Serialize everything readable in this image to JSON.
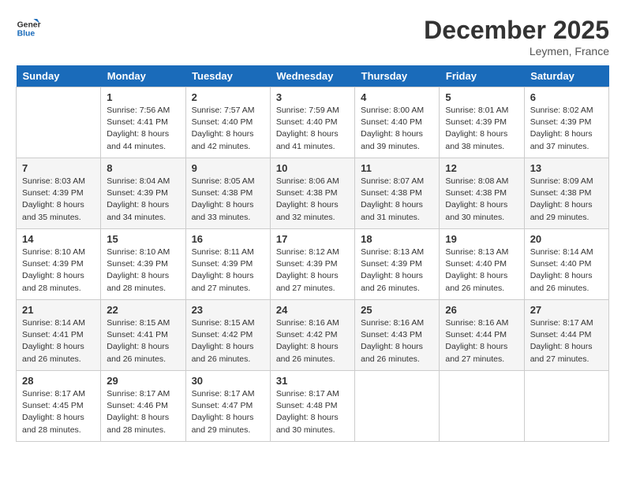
{
  "header": {
    "logo_line1": "General",
    "logo_line2": "Blue",
    "month_title": "December 2025",
    "location": "Leymen, France"
  },
  "days_of_week": [
    "Sunday",
    "Monday",
    "Tuesday",
    "Wednesday",
    "Thursday",
    "Friday",
    "Saturday"
  ],
  "weeks": [
    [
      {
        "day": "",
        "sunrise": "",
        "sunset": "",
        "daylight": ""
      },
      {
        "day": "1",
        "sunrise": "Sunrise: 7:56 AM",
        "sunset": "Sunset: 4:41 PM",
        "daylight": "Daylight: 8 hours and 44 minutes."
      },
      {
        "day": "2",
        "sunrise": "Sunrise: 7:57 AM",
        "sunset": "Sunset: 4:40 PM",
        "daylight": "Daylight: 8 hours and 42 minutes."
      },
      {
        "day": "3",
        "sunrise": "Sunrise: 7:59 AM",
        "sunset": "Sunset: 4:40 PM",
        "daylight": "Daylight: 8 hours and 41 minutes."
      },
      {
        "day": "4",
        "sunrise": "Sunrise: 8:00 AM",
        "sunset": "Sunset: 4:40 PM",
        "daylight": "Daylight: 8 hours and 39 minutes."
      },
      {
        "day": "5",
        "sunrise": "Sunrise: 8:01 AM",
        "sunset": "Sunset: 4:39 PM",
        "daylight": "Daylight: 8 hours and 38 minutes."
      },
      {
        "day": "6",
        "sunrise": "Sunrise: 8:02 AM",
        "sunset": "Sunset: 4:39 PM",
        "daylight": "Daylight: 8 hours and 37 minutes."
      }
    ],
    [
      {
        "day": "7",
        "sunrise": "Sunrise: 8:03 AM",
        "sunset": "Sunset: 4:39 PM",
        "daylight": "Daylight: 8 hours and 35 minutes."
      },
      {
        "day": "8",
        "sunrise": "Sunrise: 8:04 AM",
        "sunset": "Sunset: 4:39 PM",
        "daylight": "Daylight: 8 hours and 34 minutes."
      },
      {
        "day": "9",
        "sunrise": "Sunrise: 8:05 AM",
        "sunset": "Sunset: 4:38 PM",
        "daylight": "Daylight: 8 hours and 33 minutes."
      },
      {
        "day": "10",
        "sunrise": "Sunrise: 8:06 AM",
        "sunset": "Sunset: 4:38 PM",
        "daylight": "Daylight: 8 hours and 32 minutes."
      },
      {
        "day": "11",
        "sunrise": "Sunrise: 8:07 AM",
        "sunset": "Sunset: 4:38 PM",
        "daylight": "Daylight: 8 hours and 31 minutes."
      },
      {
        "day": "12",
        "sunrise": "Sunrise: 8:08 AM",
        "sunset": "Sunset: 4:38 PM",
        "daylight": "Daylight: 8 hours and 30 minutes."
      },
      {
        "day": "13",
        "sunrise": "Sunrise: 8:09 AM",
        "sunset": "Sunset: 4:38 PM",
        "daylight": "Daylight: 8 hours and 29 minutes."
      }
    ],
    [
      {
        "day": "14",
        "sunrise": "Sunrise: 8:10 AM",
        "sunset": "Sunset: 4:39 PM",
        "daylight": "Daylight: 8 hours and 28 minutes."
      },
      {
        "day": "15",
        "sunrise": "Sunrise: 8:10 AM",
        "sunset": "Sunset: 4:39 PM",
        "daylight": "Daylight: 8 hours and 28 minutes."
      },
      {
        "day": "16",
        "sunrise": "Sunrise: 8:11 AM",
        "sunset": "Sunset: 4:39 PM",
        "daylight": "Daylight: 8 hours and 27 minutes."
      },
      {
        "day": "17",
        "sunrise": "Sunrise: 8:12 AM",
        "sunset": "Sunset: 4:39 PM",
        "daylight": "Daylight: 8 hours and 27 minutes."
      },
      {
        "day": "18",
        "sunrise": "Sunrise: 8:13 AM",
        "sunset": "Sunset: 4:39 PM",
        "daylight": "Daylight: 8 hours and 26 minutes."
      },
      {
        "day": "19",
        "sunrise": "Sunrise: 8:13 AM",
        "sunset": "Sunset: 4:40 PM",
        "daylight": "Daylight: 8 hours and 26 minutes."
      },
      {
        "day": "20",
        "sunrise": "Sunrise: 8:14 AM",
        "sunset": "Sunset: 4:40 PM",
        "daylight": "Daylight: 8 hours and 26 minutes."
      }
    ],
    [
      {
        "day": "21",
        "sunrise": "Sunrise: 8:14 AM",
        "sunset": "Sunset: 4:41 PM",
        "daylight": "Daylight: 8 hours and 26 minutes."
      },
      {
        "day": "22",
        "sunrise": "Sunrise: 8:15 AM",
        "sunset": "Sunset: 4:41 PM",
        "daylight": "Daylight: 8 hours and 26 minutes."
      },
      {
        "day": "23",
        "sunrise": "Sunrise: 8:15 AM",
        "sunset": "Sunset: 4:42 PM",
        "daylight": "Daylight: 8 hours and 26 minutes."
      },
      {
        "day": "24",
        "sunrise": "Sunrise: 8:16 AM",
        "sunset": "Sunset: 4:42 PM",
        "daylight": "Daylight: 8 hours and 26 minutes."
      },
      {
        "day": "25",
        "sunrise": "Sunrise: 8:16 AM",
        "sunset": "Sunset: 4:43 PM",
        "daylight": "Daylight: 8 hours and 26 minutes."
      },
      {
        "day": "26",
        "sunrise": "Sunrise: 8:16 AM",
        "sunset": "Sunset: 4:44 PM",
        "daylight": "Daylight: 8 hours and 27 minutes."
      },
      {
        "day": "27",
        "sunrise": "Sunrise: 8:17 AM",
        "sunset": "Sunset: 4:44 PM",
        "daylight": "Daylight: 8 hours and 27 minutes."
      }
    ],
    [
      {
        "day": "28",
        "sunrise": "Sunrise: 8:17 AM",
        "sunset": "Sunset: 4:45 PM",
        "daylight": "Daylight: 8 hours and 28 minutes."
      },
      {
        "day": "29",
        "sunrise": "Sunrise: 8:17 AM",
        "sunset": "Sunset: 4:46 PM",
        "daylight": "Daylight: 8 hours and 28 minutes."
      },
      {
        "day": "30",
        "sunrise": "Sunrise: 8:17 AM",
        "sunset": "Sunset: 4:47 PM",
        "daylight": "Daylight: 8 hours and 29 minutes."
      },
      {
        "day": "31",
        "sunrise": "Sunrise: 8:17 AM",
        "sunset": "Sunset: 4:48 PM",
        "daylight": "Daylight: 8 hours and 30 minutes."
      },
      {
        "day": "",
        "sunrise": "",
        "sunset": "",
        "daylight": ""
      },
      {
        "day": "",
        "sunrise": "",
        "sunset": "",
        "daylight": ""
      },
      {
        "day": "",
        "sunrise": "",
        "sunset": "",
        "daylight": ""
      }
    ]
  ]
}
